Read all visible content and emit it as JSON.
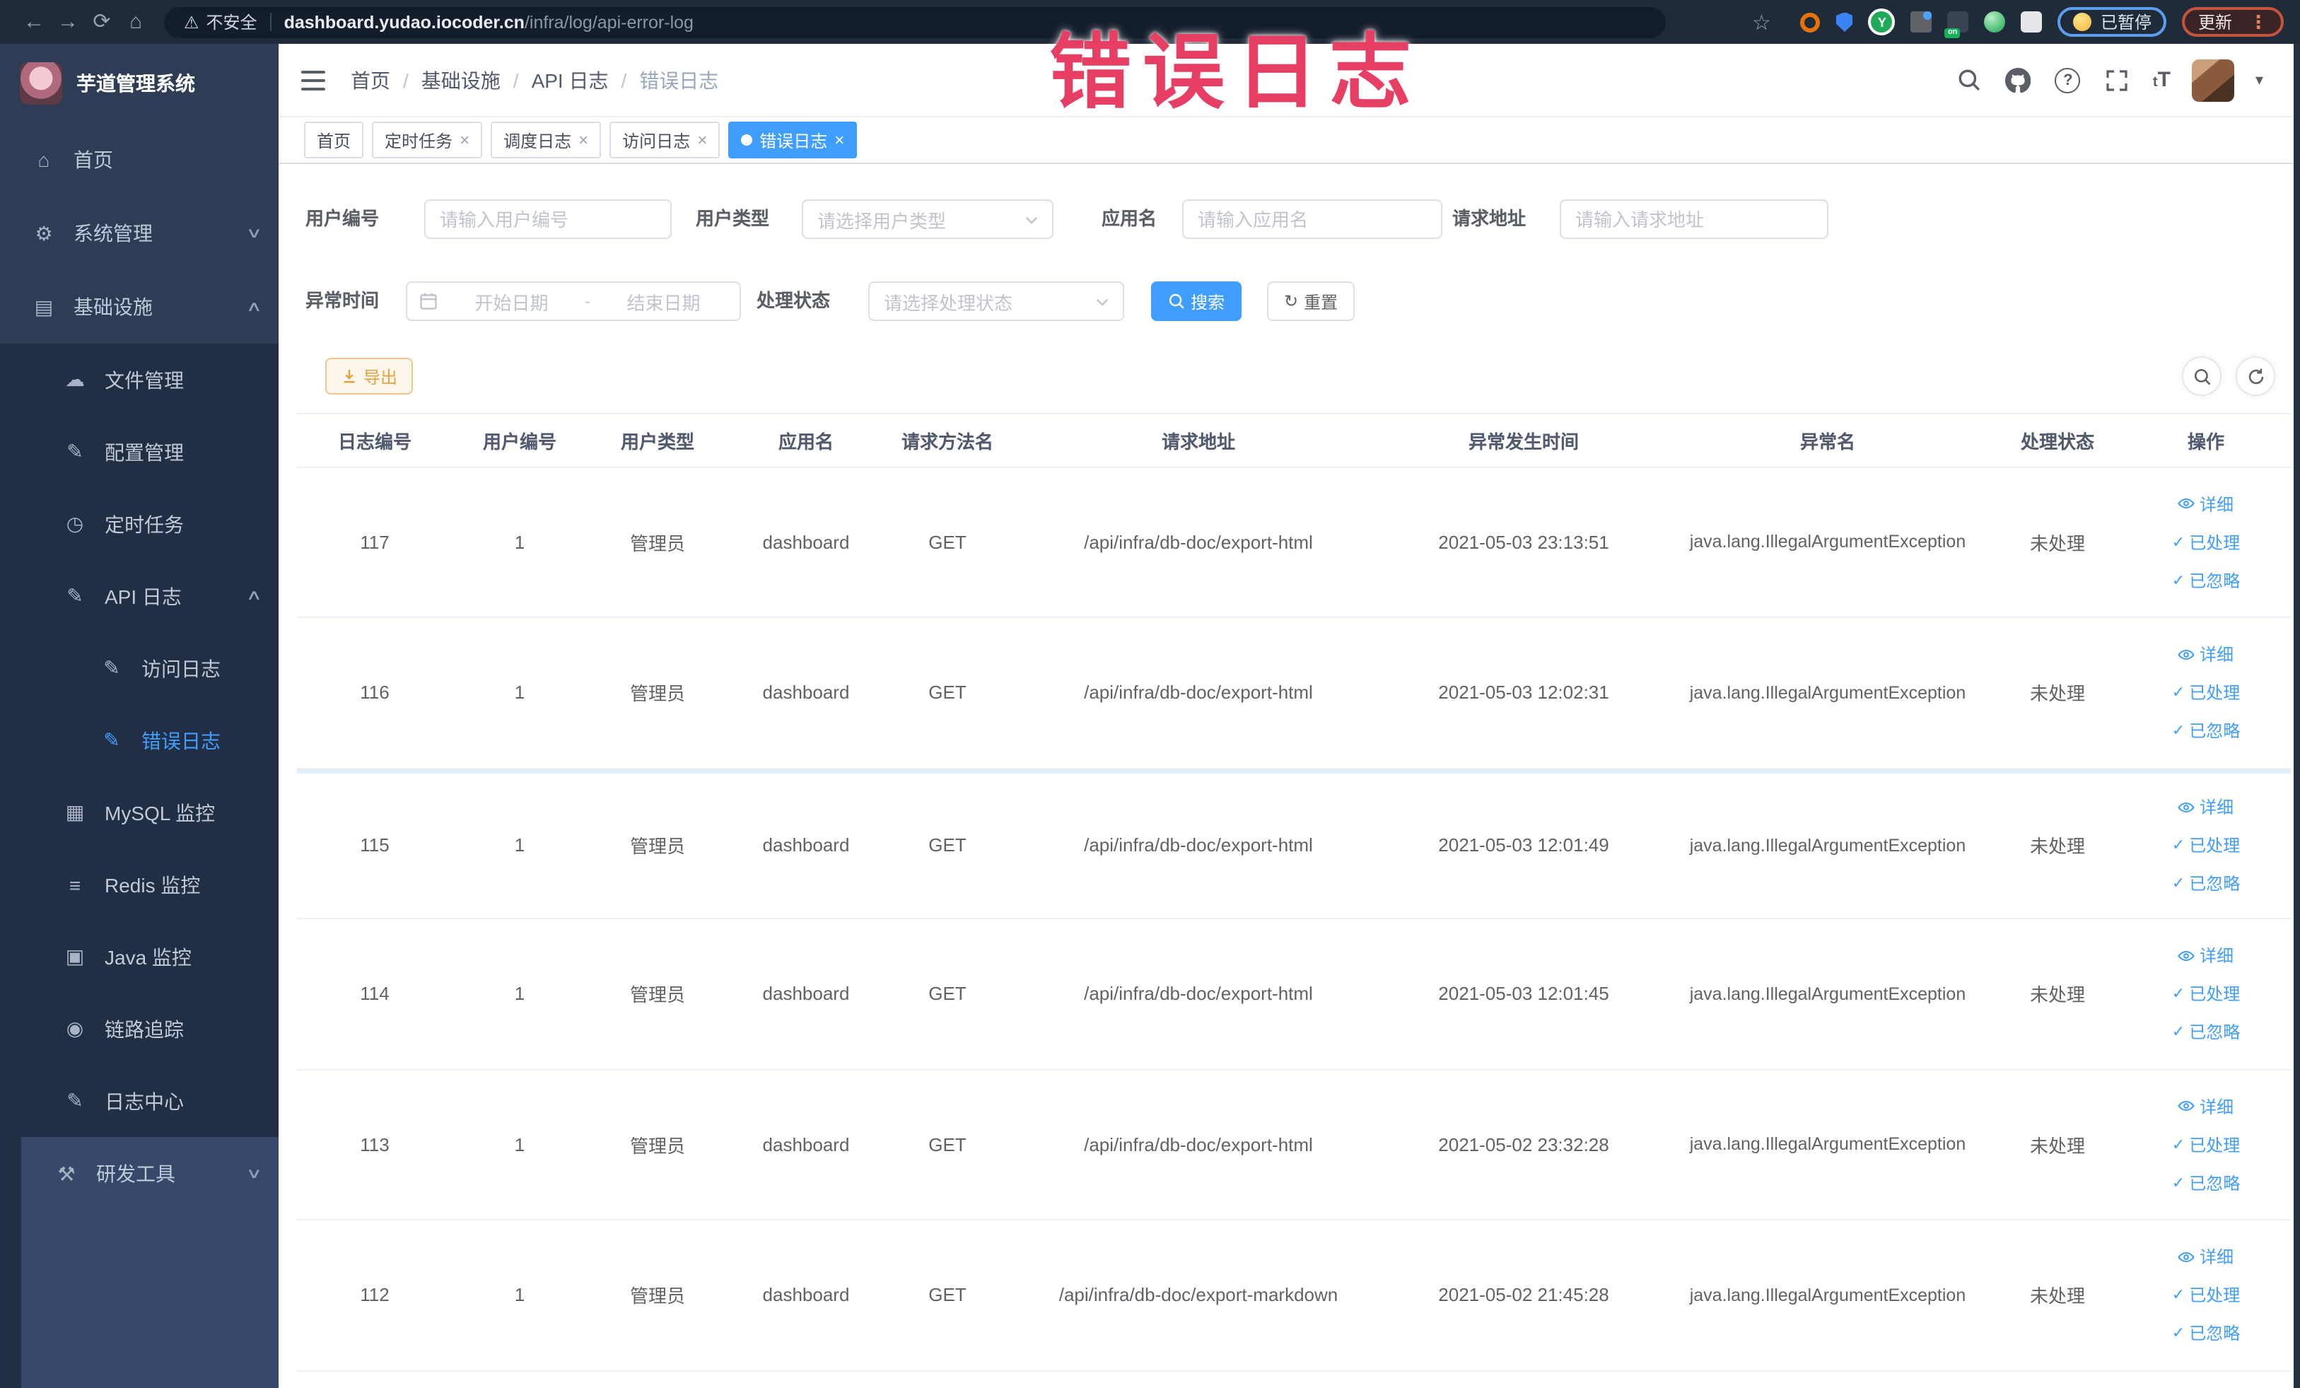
{
  "browser": {
    "security_label": "不安全",
    "url_domain": "dashboard.yudao.iocoder.cn",
    "url_path": "/infra/log/api-error-log",
    "paused_badge": "已暂停",
    "update_badge": "更新"
  },
  "watermark": "错误日志",
  "icons": {
    "back": "←",
    "forward": "→",
    "reload": "⟳",
    "home_btn": "⌂",
    "warning": "⚠",
    "star": "☆",
    "y_badge": "Y",
    "on_badge": "on",
    "menu_dots": "⋮",
    "caret": "▾",
    "close": "×",
    "breadcrumb_sep": "/",
    "home": "⌂",
    "gear": "⚙",
    "infra": "▤",
    "cloud": "☁",
    "edit": "✎",
    "clock": "◷",
    "log": "✎",
    "chart": "▦",
    "stack": "≡",
    "monitor": "▣",
    "trace": "◉",
    "tools": "⚒",
    "arrow_down": "∨",
    "arrow_up": "∧",
    "check": "✓",
    "refresh": "↻",
    "fontsize": "T"
  },
  "sidebar": {
    "title": "芋道管理系统",
    "items": [
      {
        "label": "首页"
      },
      {
        "label": "系统管理"
      },
      {
        "label": "基础设施"
      },
      {
        "label": "文件管理"
      },
      {
        "label": "配置管理"
      },
      {
        "label": "定时任务"
      },
      {
        "label": "API 日志"
      },
      {
        "label": "访问日志"
      },
      {
        "label": "错误日志"
      },
      {
        "label": "MySQL 监控"
      },
      {
        "label": "Redis 监控"
      },
      {
        "label": "Java 监控"
      },
      {
        "label": "链路追踪"
      },
      {
        "label": "日志中心"
      },
      {
        "label": "研发工具"
      }
    ]
  },
  "breadcrumb": {
    "items": [
      "首页",
      "基础设施",
      "API 日志",
      "错误日志"
    ]
  },
  "tabs": [
    {
      "label": "首页"
    },
    {
      "label": "定时任务"
    },
    {
      "label": "调度日志"
    },
    {
      "label": "访问日志"
    },
    {
      "label": "错误日志"
    }
  ],
  "filters": {
    "user_id": {
      "label": "用户编号",
      "placeholder": "请输入用户编号"
    },
    "user_type": {
      "label": "用户类型",
      "placeholder": "请选择用户类型"
    },
    "app_name": {
      "label": "应用名",
      "placeholder": "请输入应用名"
    },
    "request_url": {
      "label": "请求地址",
      "placeholder": "请输入请求地址"
    },
    "exception_time": {
      "label": "异常时间",
      "start_placeholder": "开始日期",
      "end_placeholder": "结束日期",
      "separator": "-"
    },
    "process_status": {
      "label": "处理状态",
      "placeholder": "请选择处理状态"
    },
    "search_label": "搜索",
    "reset_label": "重置"
  },
  "toolbar": {
    "export_label": "导出"
  },
  "table": {
    "headers": [
      "日志编号",
      "用户编号",
      "用户类型",
      "应用名",
      "请求方法名",
      "请求地址",
      "异常发生时间",
      "异常名",
      "处理状态",
      "操作"
    ],
    "action_labels": [
      "详细",
      "已处理",
      "已忽略"
    ],
    "rows": [
      {
        "id": "117",
        "user_id": "1",
        "user_type": "管理员",
        "app": "dashboard",
        "method": "GET",
        "url": "/api/infra/db-doc/export-html",
        "time": "2021-05-03 23:13:51",
        "exception": "java.lang.IllegalArgumentException",
        "status": "未处理"
      },
      {
        "id": "116",
        "user_id": "1",
        "user_type": "管理员",
        "app": "dashboard",
        "method": "GET",
        "url": "/api/infra/db-doc/export-html",
        "time": "2021-05-03 12:02:31",
        "exception": "java.lang.IllegalArgumentException",
        "status": "未处理"
      },
      {
        "id": "115",
        "user_id": "1",
        "user_type": "管理员",
        "app": "dashboard",
        "method": "GET",
        "url": "/api/infra/db-doc/export-html",
        "time": "2021-05-03 12:01:49",
        "exception": "java.lang.IllegalArgumentException",
        "status": "未处理"
      },
      {
        "id": "114",
        "user_id": "1",
        "user_type": "管理员",
        "app": "dashboard",
        "method": "GET",
        "url": "/api/infra/db-doc/export-html",
        "time": "2021-05-03 12:01:45",
        "exception": "java.lang.IllegalArgumentException",
        "status": "未处理"
      },
      {
        "id": "113",
        "user_id": "1",
        "user_type": "管理员",
        "app": "dashboard",
        "method": "GET",
        "url": "/api/infra/db-doc/export-html",
        "time": "2021-05-02 23:32:28",
        "exception": "java.lang.IllegalArgumentException",
        "status": "未处理"
      },
      {
        "id": "112",
        "user_id": "1",
        "user_type": "管理员",
        "app": "dashboard",
        "method": "GET",
        "url": "/api/infra/db-doc/export-markdown",
        "time": "2021-05-02 21:45:28",
        "exception": "java.lang.IllegalArgumentException",
        "status": "未处理"
      }
    ]
  },
  "colors": {
    "accent": "#409EFF",
    "warning": "#e6a23c",
    "annotation": "#e73e64",
    "sidebar_bg": "#2e3c55"
  }
}
